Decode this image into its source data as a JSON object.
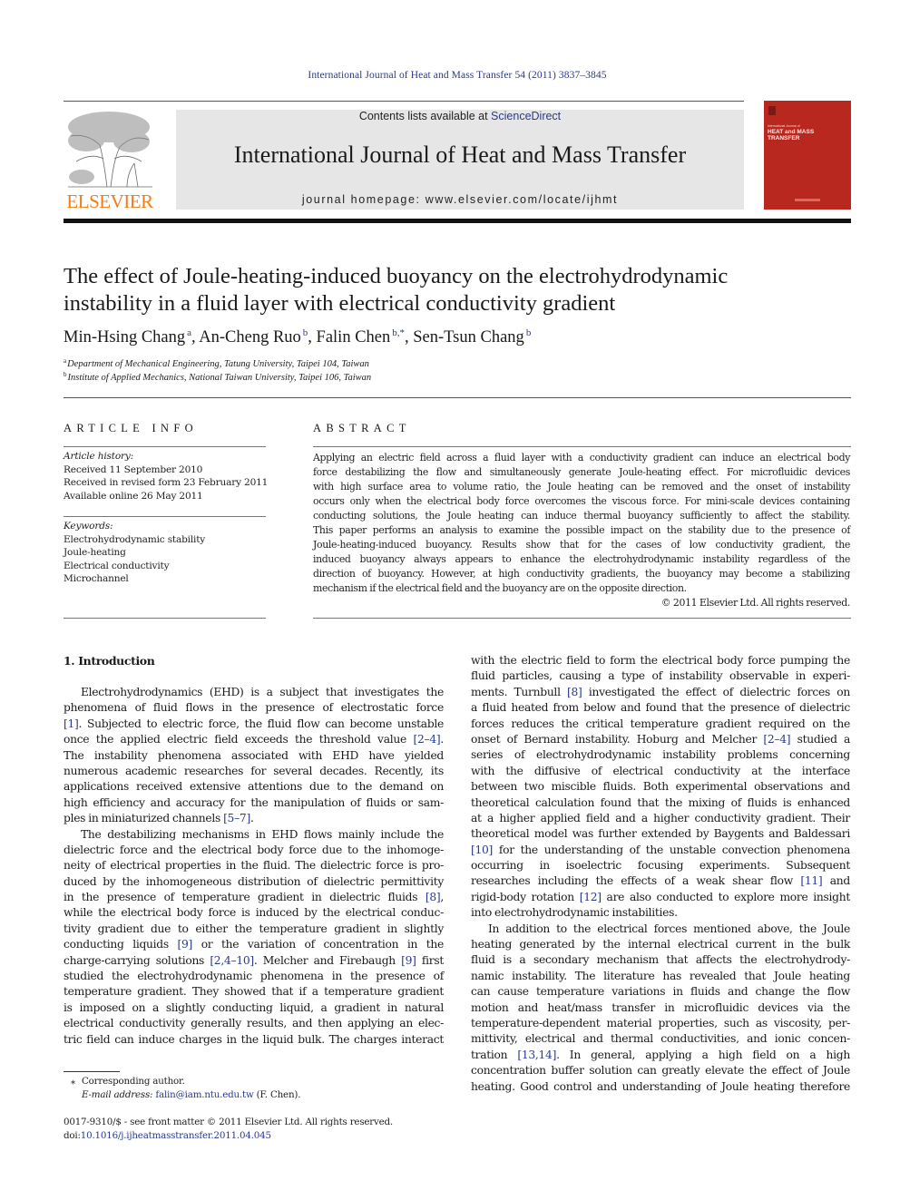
{
  "header": {
    "citation": "International Journal of Heat and Mass Transfer 54 (2011) 3837–3845",
    "contents_prefix": "Contents lists available at ",
    "contents_link": "ScienceDirect",
    "journal_name": "International Journal of Heat and Mass Transfer",
    "homepage_prefix": "journal homepage: ",
    "homepage_url": "www.elsevier.com/locate/ijhmt",
    "publisher": "ELSEVIER",
    "cover": {
      "subtitle": "International Journal of",
      "title_line1": "HEAT and MASS",
      "title_line2": "TRANSFER",
      "color": "#b8281e"
    },
    "publisher_color": "#f07c1b",
    "link_color": "#2a3a8c"
  },
  "article": {
    "title_line1": "The effect of Joule-heating-induced buoyancy on the electrohydrodynamic",
    "title_line2": "instability in a fluid layer with electrical conductivity gradient",
    "authors": [
      {
        "name": "Min-Hsing Chang",
        "sup": "a",
        "sep": ", "
      },
      {
        "name": "An-Cheng Ruo",
        "sup": "b",
        "sep": ", "
      },
      {
        "name": "Falin Chen",
        "sup": "b,*",
        "sep": ", "
      },
      {
        "name": "Sen-Tsun Chang",
        "sup": "b",
        "sep": ""
      }
    ],
    "affiliations": [
      {
        "sup": "a",
        "text": "Department of Mechanical Engineering, Tatung University, Taipei 104, Taiwan"
      },
      {
        "sup": "b",
        "text": "Institute of Applied Mechanics, National Taiwan University, Taipei 106, Taiwan"
      }
    ]
  },
  "article_info": {
    "heading": "ARTICLE INFO",
    "history_label": "Article history:",
    "history": [
      "Received 11 September 2010",
      "Received in revised form 23 February 2011",
      "Available online 26 May 2011"
    ],
    "keywords_label": "Keywords:",
    "keywords": [
      "Electrohydrodynamic stability",
      "Joule-heating",
      "Electrical conductivity",
      "Microchannel"
    ]
  },
  "abstract": {
    "heading": "ABSTRACT",
    "lines": [
      "Applying an electric field across a fluid layer with a conductivity gradient can induce an electrical body",
      "force destabilizing the flow and simultaneously generate Joule-heating effect. For microfluidic devices",
      "with high surface area to volume ratio, the Joule heating can be removed and the onset of instability",
      "occurs only when the electrical body force overcomes the viscous force. For mini-scale devices containing",
      "conducting solutions, the Joule heating can induce thermal buoyancy sufficiently to affect the stability.",
      "This paper performs an analysis to examine the possible impact on the stability due to the presence of",
      "Joule-heating-induced buoyancy. Results show that for the cases of low conductivity gradient, the",
      "induced buoyancy always appears to enhance the electrohydrodynamic instability regardless of the",
      "direction of buoyancy. However, at high conductivity gradients, the buoyancy may become a stabilizing",
      "mechanism if the electrical field and the buoyancy are on the opposite direction."
    ],
    "copyright": "© 2011 Elsevier Ltd. All rights reserved."
  },
  "body": {
    "section_heading": "1. Introduction",
    "left_column": [
      {
        "t": "Electrohydrodynamics (EHD) is a subject that investigates the",
        "indent": true
      },
      {
        "t": "phenomena of fluid flows in the presence of electrostatic force"
      },
      {
        "t": "[1]. Subjected to electric force, the fluid flow can become unstable"
      },
      {
        "t": "once the applied electric field exceeds the threshold value [2–4]."
      },
      {
        "t": "The instability phenomena associated with EHD have yielded"
      },
      {
        "t": "numerous academic researches for several decades. Recently, its"
      },
      {
        "t": "applications received extensive attentions due to the demand on"
      },
      {
        "t": "high efficiency and accuracy for the manipulation of fluids or sam-"
      },
      {
        "t": "ples in miniaturized channels [5–7].",
        "last": true
      },
      {
        "t": "The destabilizing mechanisms in EHD flows mainly include the",
        "indent": true
      },
      {
        "t": "dielectric force and the electrical body force due to the inhomoge-"
      },
      {
        "t": "neity of electrical properties in the fluid. The dielectric force is pro-"
      },
      {
        "t": "duced by the inhomogeneous distribution of dielectric permittivity"
      },
      {
        "t": "in the presence of temperature gradient in dielectric fluids [8],"
      },
      {
        "t": "while the electrical body force is induced by the electrical conduc-"
      },
      {
        "t": "tivity gradient due to either the temperature gradient in slightly"
      },
      {
        "t": "conducting liquids [9] or the variation of concentration in the"
      },
      {
        "t": "charge-carrying solutions [2,4–10]. Melcher and Firebaugh [9] first"
      },
      {
        "t": "studied the electrohydrodynamic phenomena in the presence of"
      },
      {
        "t": "temperature gradient. They showed that if a temperature gradient"
      },
      {
        "t": "is imposed on a slightly conducting liquid, a gradient in natural"
      },
      {
        "t": "electrical conductivity generally results, and then applying an elec-"
      },
      {
        "t": "tric field can induce charges in the liquid bulk. The charges interact"
      }
    ],
    "right_column": [
      {
        "t": "with the electric field to form the electrical body force pumping the"
      },
      {
        "t": "fluid particles, causing a type of instability observable in experi-"
      },
      {
        "t": "ments. Turnbull [8] investigated the effect of dielectric forces on"
      },
      {
        "t": "a fluid heated from below and found that the presence of dielectric"
      },
      {
        "t": "forces reduces the critical temperature gradient required on the"
      },
      {
        "t": "onset of Bernard instability. Hoburg and Melcher [2–4] studied a"
      },
      {
        "t": "series of electrohydrodynamic instability problems concerning"
      },
      {
        "t": "with the diffusive of electrical conductivity at the interface"
      },
      {
        "t": "between two miscible fluids. Both experimental observations and"
      },
      {
        "t": "theoretical calculation found that the mixing of fluids is enhanced"
      },
      {
        "t": "at a higher applied field and a higher conductivity gradient. Their"
      },
      {
        "t": "theoretical model was further extended by Baygents and Baldessari"
      },
      {
        "t": "[10] for the understanding of the unstable convection phenomena"
      },
      {
        "t": "occurring in isoelectric focusing experiments. Subsequent"
      },
      {
        "t": "researches including the effects of a weak shear flow [11] and"
      },
      {
        "t": "rigid-body rotation [12] are also conducted to explore more insight"
      },
      {
        "t": "into electrohydrodynamic instabilities.",
        "last": true
      },
      {
        "t": "In addition to the electrical forces mentioned above, the Joule",
        "indent": true
      },
      {
        "t": "heating generated by the internal electrical current in the bulk"
      },
      {
        "t": "fluid is a secondary mechanism that affects the electrohydrody-"
      },
      {
        "t": "namic instability. The literature has revealed that Joule heating"
      },
      {
        "t": "can cause temperature variations in fluids and change the flow"
      },
      {
        "t": "motion and heat/mass transfer in microfluidic devices via the"
      },
      {
        "t": "temperature-dependent material properties, such as viscosity, per-"
      },
      {
        "t": "mittivity, electrical and thermal conductivities, and ionic concen-"
      },
      {
        "t": "tration [13,14]. In general, applying a high field on a high"
      },
      {
        "t": "concentration buffer solution can greatly elevate the effect of Joule"
      },
      {
        "t": "heating. Good control and understanding of Joule heating therefore"
      }
    ]
  },
  "footnote": {
    "star": "⁎",
    "corresponding": "Corresponding author.",
    "email_label": "E-mail address: ",
    "email": "falin@iam.ntu.edu.tw",
    "email_suffix": " (F. Chen).",
    "issn_line": "0017-9310/$ - see front matter © 2011 Elsevier Ltd. All rights reserved.",
    "doi_prefix": "doi:",
    "doi": "10.1016/j.ijheatmasstransfer.2011.04.045"
  }
}
